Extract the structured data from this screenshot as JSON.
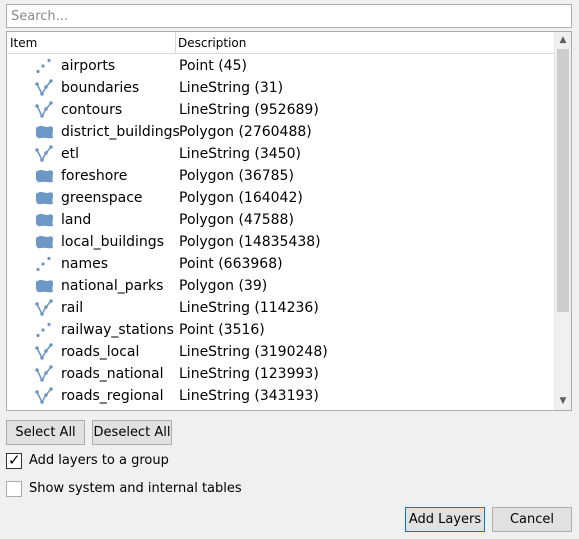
{
  "search": {
    "placeholder": "Search...",
    "value": ""
  },
  "columns": {
    "item": "Item",
    "description": "Description"
  },
  "layers": [
    {
      "name": "airports",
      "desc": "Point (45)",
      "icon": "point"
    },
    {
      "name": "boundaries",
      "desc": "LineString (31)",
      "icon": "line"
    },
    {
      "name": "contours",
      "desc": "LineString (952689)",
      "icon": "line"
    },
    {
      "name": "district_buildings",
      "desc": "Polygon (2760488)",
      "icon": "polygon"
    },
    {
      "name": "etl",
      "desc": "LineString (3450)",
      "icon": "line"
    },
    {
      "name": "foreshore",
      "desc": "Polygon (36785)",
      "icon": "polygon"
    },
    {
      "name": "greenspace",
      "desc": "Polygon (164042)",
      "icon": "polygon"
    },
    {
      "name": "land",
      "desc": "Polygon (47588)",
      "icon": "polygon"
    },
    {
      "name": "local_buildings",
      "desc": "Polygon (14835438)",
      "icon": "polygon"
    },
    {
      "name": "names",
      "desc": "Point (663968)",
      "icon": "point"
    },
    {
      "name": "national_parks",
      "desc": "Polygon (39)",
      "icon": "polygon"
    },
    {
      "name": "rail",
      "desc": "LineString (114236)",
      "icon": "line"
    },
    {
      "name": "railway_stations",
      "desc": "Point (3516)",
      "icon": "point"
    },
    {
      "name": "roads_local",
      "desc": "LineString (3190248)",
      "icon": "line"
    },
    {
      "name": "roads_national",
      "desc": "LineString (123993)",
      "icon": "line"
    },
    {
      "name": "roads_regional",
      "desc": "LineString (343193)",
      "icon": "line"
    },
    {
      "name": "",
      "desc": "",
      "icon": "polygon"
    }
  ],
  "buttons": {
    "select_all": "Select All",
    "deselect_all": "Deselect All",
    "add_layers": "Add Layers",
    "cancel": "Cancel"
  },
  "options": {
    "add_to_group": {
      "label": "Add layers to a group",
      "checked": true
    },
    "show_system": {
      "label": "Show system and internal tables",
      "checked": false
    }
  },
  "colors": {
    "icon": "#6d97c4",
    "accent": "#0078d7"
  }
}
